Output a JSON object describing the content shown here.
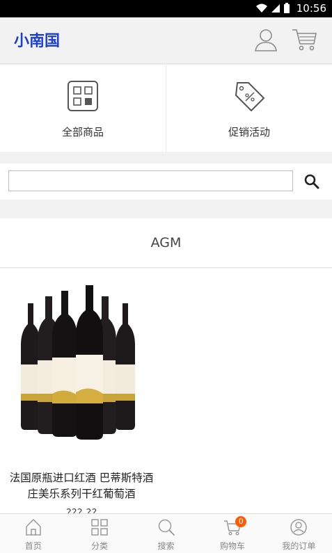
{
  "status_bar": {
    "time": "10:56"
  },
  "header": {
    "brand": "小南国"
  },
  "quick_links": [
    {
      "label": "全部商品",
      "icon": "grid-icon"
    },
    {
      "label": "促销活动",
      "icon": "tag-icon"
    }
  ],
  "search": {
    "value": "",
    "placeholder": ""
  },
  "section": {
    "title": "AGM"
  },
  "products": [
    {
      "name": "法国原瓶进口红酒 巴蒂斯特酒庄美乐系列干红葡萄酒",
      "price": "???.??"
    }
  ],
  "tabbar": {
    "items": [
      {
        "label": "首页",
        "icon": "home-icon"
      },
      {
        "label": "分类",
        "icon": "category-icon"
      },
      {
        "label": "搜索",
        "icon": "search-icon"
      },
      {
        "label": "购物车",
        "icon": "cart-icon",
        "badge": "0"
      },
      {
        "label": "我的订单",
        "icon": "orders-icon"
      }
    ]
  },
  "colors": {
    "brand": "#1a3fd6",
    "badge": "#ff5a00",
    "icon_gray": "#888888"
  }
}
